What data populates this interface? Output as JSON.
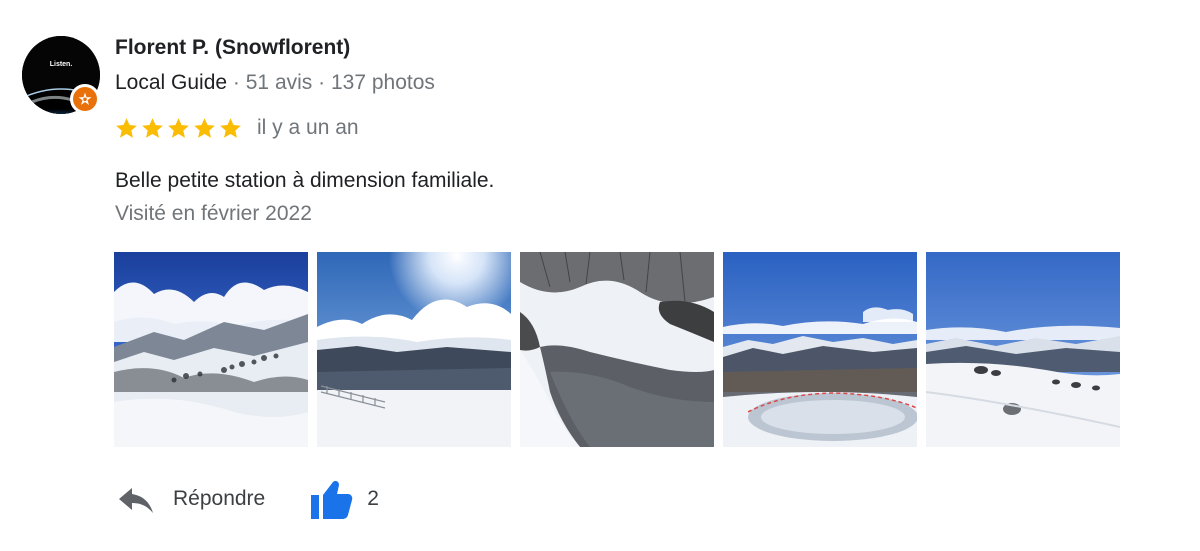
{
  "author": {
    "name": "Florent P. (Snowflorent)",
    "badge": "Local Guide",
    "separator": " · ",
    "reviews": "51 avis",
    "photos": "137 photos",
    "avatar_text": "Listen."
  },
  "review": {
    "rating": 5,
    "rating_max": 5,
    "date": "il y a un an",
    "text": "Belle petite station à dimension familiale.",
    "visited": "Visité en février 2022"
  },
  "photos": [
    {
      "name": "photo-snowy-slope-clouds"
    },
    {
      "name": "photo-sun-clouds-fence"
    },
    {
      "name": "photo-frozen-stream"
    },
    {
      "name": "photo-mountain-panorama-lake"
    },
    {
      "name": "photo-snow-field-rocks"
    }
  ],
  "actions": {
    "reply_label": "Répondre",
    "like_count": "2"
  },
  "colors": {
    "star": "#fbbc04",
    "like": "#1a73e8",
    "badge": "#e8710a",
    "muted_text": "#70757a",
    "text": "#202124"
  }
}
